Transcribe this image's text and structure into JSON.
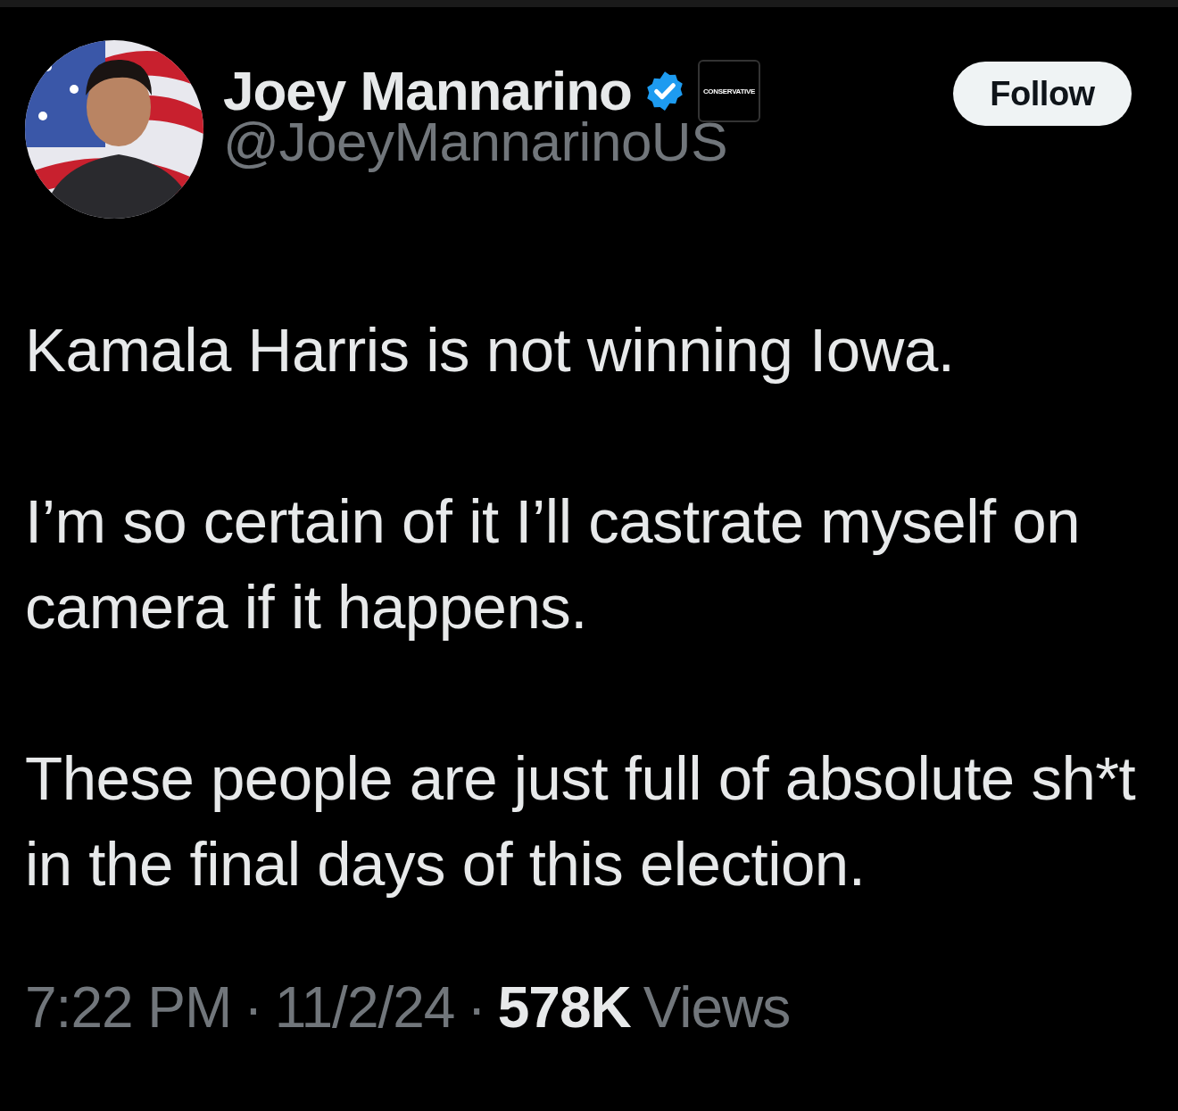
{
  "author": {
    "name": "Joey Mannarino",
    "verified": true,
    "affiliate_badge": "CONSERVATIVE",
    "handle": "@JoeyMannarinoUS"
  },
  "follow_button": {
    "label": "Follow"
  },
  "paragraphs": [
    "Kamala Harris is not winning Iowa.",
    "I’m so certain of it I’ll castrate myself on camera if it happens.",
    "These people are just full of absolute sh*t in the final days of this election."
  ],
  "footer": {
    "time": "7:22 PM",
    "separators": [
      "·",
      "·"
    ],
    "date": "11/2/24",
    "views_count": "578K",
    "views_label": "Views"
  }
}
